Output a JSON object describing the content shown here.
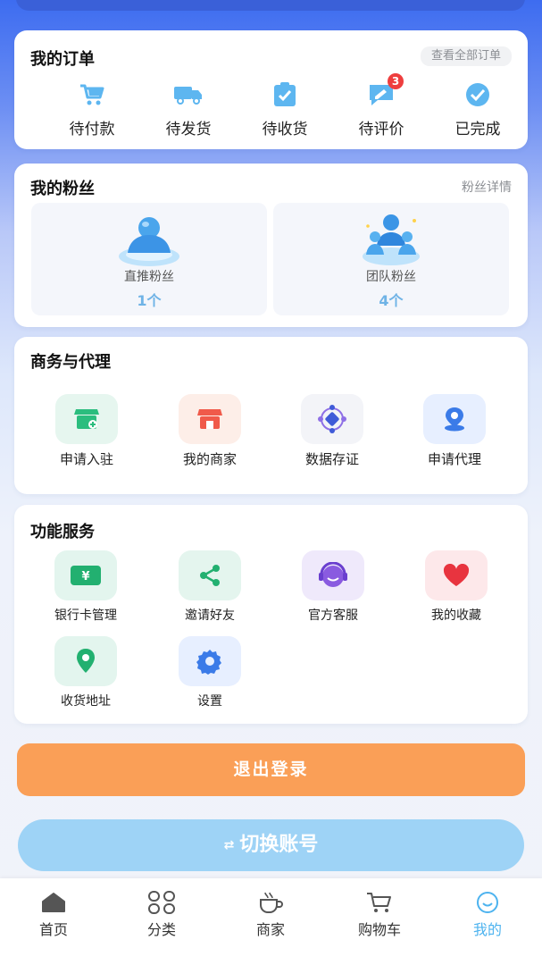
{
  "orders": {
    "title": "我的订单",
    "link": "查看全部订单",
    "items": [
      {
        "label": "待付款",
        "icon": "cart-icon"
      },
      {
        "label": "待发货",
        "icon": "truck-icon"
      },
      {
        "label": "待收货",
        "icon": "clipboard-check-icon"
      },
      {
        "label": "待评价",
        "icon": "review-icon",
        "badge": "3"
      },
      {
        "label": "已完成",
        "icon": "check-circle-icon"
      }
    ]
  },
  "fans": {
    "title": "我的粉丝",
    "link": "粉丝详情",
    "items": [
      {
        "label": "直推粉丝",
        "count": "1个",
        "icon": "single-user-3d-icon"
      },
      {
        "label": "团队粉丝",
        "count": "4个",
        "icon": "team-users-3d-icon"
      }
    ]
  },
  "business": {
    "title": "商务与代理",
    "items": [
      {
        "label": "申请入驻",
        "icon": "store-add-icon",
        "bg": "#e6f6ef",
        "color": "#2bbd7e"
      },
      {
        "label": "我的商家",
        "icon": "shop-icon",
        "bg": "#fdeee8",
        "color": "#f05a4a"
      },
      {
        "label": "数据存证",
        "icon": "data-network-icon",
        "bg": "#f3f4f8",
        "color": "#3f5bd8"
      },
      {
        "label": "申请代理",
        "icon": "location-agent-icon",
        "bg": "#e7efff",
        "color": "#3b7be8"
      }
    ]
  },
  "services": {
    "title": "功能服务",
    "items": [
      {
        "label": "银行卡管理",
        "icon": "bank-card-icon",
        "bg": "#e3f5ee",
        "color": "#22b070"
      },
      {
        "label": "邀请好友",
        "icon": "share-icon",
        "bg": "#e4f5ee",
        "color": "#22b070"
      },
      {
        "label": "官方客服",
        "icon": "headset-icon",
        "bg": "#efe9fb",
        "color": "#8a5be0"
      },
      {
        "label": "我的收藏",
        "icon": "heart-icon",
        "bg": "#fde8ea",
        "color": "#e8343f"
      },
      {
        "label": "收货地址",
        "icon": "map-pin-icon",
        "bg": "#e3f5ee",
        "color": "#22b070"
      },
      {
        "label": "设置",
        "icon": "gear-icon",
        "bg": "#e7efff",
        "color": "#3b7be8"
      }
    ]
  },
  "buttons": {
    "logout": "退出登录",
    "switch": "切换账号",
    "switch_icon": "⇄"
  },
  "tabbar": {
    "items": [
      {
        "label": "首页",
        "icon": "home-icon"
      },
      {
        "label": "分类",
        "icon": "category-icon"
      },
      {
        "label": "商家",
        "icon": "coffee-icon"
      },
      {
        "label": "购物车",
        "icon": "cart-icon"
      },
      {
        "label": "我的",
        "icon": "smile-icon",
        "active": true
      }
    ],
    "active_color": "#4db3ef"
  }
}
